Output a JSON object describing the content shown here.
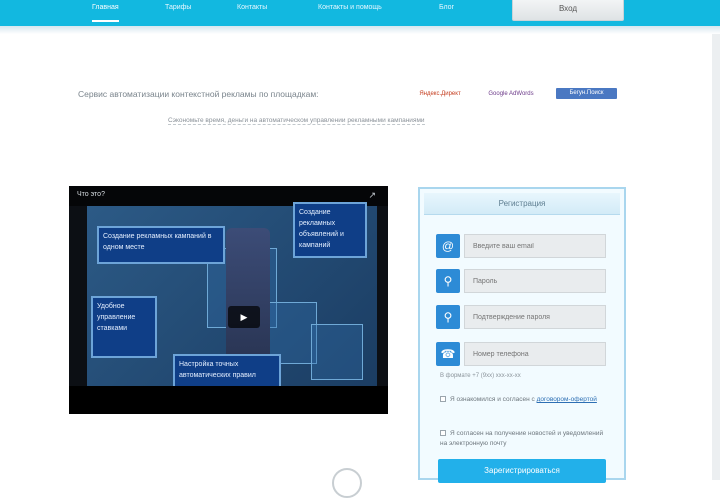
{
  "nav": {
    "items": [
      "Главная",
      "Тарифы",
      "Контакты",
      "Контакты и помощь",
      "Блог"
    ],
    "login": "Вход"
  },
  "hero": {
    "tagline": "Сервис автоматизации контекстной рекламы по площадкам:",
    "platforms": [
      "Яндекс.Директ",
      "Google AdWords",
      "Бегун.Поиск"
    ],
    "subline": "Сэкономьте время, деньги на автоматическом управлении рекламными кампаниями"
  },
  "video": {
    "title": "Что это?",
    "cards": [
      "Создание рекламных кампаний в одном месте",
      "Создание рекламных объявлений и кампаний",
      "Удобное управление ставками",
      "Настройка точных автоматических правил"
    ]
  },
  "form": {
    "title": "Регистрация",
    "placeholders": [
      "Введите ваш email",
      "Пароль",
      "Подтверждение пароля",
      "Номер телефона"
    ],
    "hint": "В формате +7 (9xx) xxx-xx-xx",
    "agree_text": "Я ознакомился и согласен с",
    "agree_link": "договором-офертой",
    "subscribe_text": "Я согласен на получение новостей и уведомлений на электронную почту",
    "submit": "Зарегистрироваться"
  },
  "colors": {
    "brand": "#12b8e0",
    "button": "#22b0ea",
    "icon": "#2d8bd6"
  }
}
